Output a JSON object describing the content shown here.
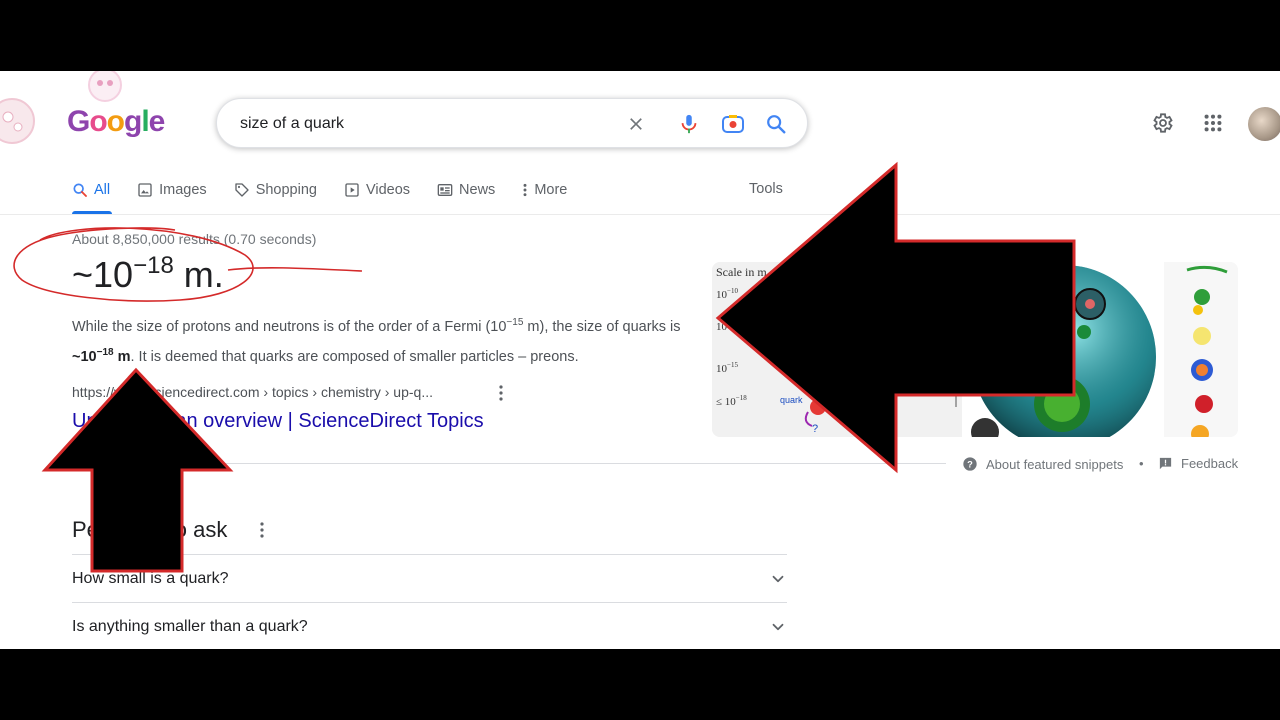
{
  "search": {
    "query": "size of a quark"
  },
  "logo": {
    "letters": [
      "G",
      "o",
      "o",
      "g",
      "l",
      "e"
    ]
  },
  "tabs": [
    {
      "label": "All",
      "icon": "search-icon",
      "active": true
    },
    {
      "label": "Images",
      "icon": "image-icon"
    },
    {
      "label": "Shopping",
      "icon": "tag-icon"
    },
    {
      "label": "Videos",
      "icon": "play-icon"
    },
    {
      "label": "News",
      "icon": "news-icon"
    },
    {
      "label": "More",
      "icon": "more-vert-icon"
    }
  ],
  "tools_label": "Tools",
  "results_stats": "About 8,850,000 results (0.70 seconds)",
  "featured_snippet": {
    "answer_prefix": "~10",
    "answer_exponent": "−18",
    "answer_suffix": " m.",
    "text_part1": "While the size of protons and neutrons is of the order of a Fermi (10",
    "text_exp1": "−15",
    "text_part2": " m), the size of quarks is ",
    "text_bold_prefix": "~10",
    "text_bold_exp": "−18",
    "text_bold_suffix": " m",
    "text_part3": ". It is deemed that quarks are composed of smaller particles – preons.",
    "cite": "https://www.sciencedirect.com › topics › chemistry › up-q...",
    "title": "Up Quark - an overview | ScienceDirect Topics"
  },
  "snippet_image": {
    "scale_label": "Scale in m",
    "ticks": [
      "10",
      "10",
      "10",
      "10",
      "≤ 10"
    ],
    "tick_exps": [
      "−10",
      "−14",
      "−15",
      "−18",
      "−18"
    ],
    "quark_label": "quark"
  },
  "snippet_footer": {
    "about": "About featured snippets",
    "separator": "•",
    "feedback": "Feedback"
  },
  "people_also_ask": {
    "title": "People also ask",
    "questions": [
      "How small is a quark?",
      "Is anything smaller than a quark?"
    ]
  },
  "colors": {
    "link": "#1a0dab",
    "accent": "#1a73e8",
    "annotation_red": "#d42a2a"
  }
}
